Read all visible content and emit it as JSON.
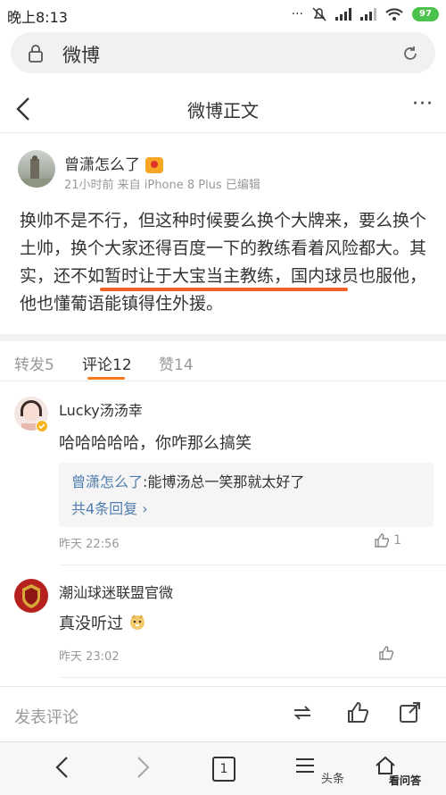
{
  "status_bar": {
    "time": "晚上8:13",
    "battery": "97"
  },
  "browser_url": {
    "text": "微博"
  },
  "nav": {
    "title": "微博正文",
    "more": "···"
  },
  "post": {
    "author": "曾潇怎么了",
    "meta": "21小时前 来自 iPhone 8 Plus 已编辑",
    "text": "换帅不是不行，但这种时候要么换个大牌来，要么换个土帅，换个大家还得百度一下的教练看着风险都大。其实，还不如暂时让于大宝当主教练，国内球员也服他，他也懂葡语能镇得住外援。"
  },
  "tabs": [
    {
      "label": "转发5"
    },
    {
      "label": "评论12"
    },
    {
      "label": "赞14"
    }
  ],
  "comments": [
    {
      "user": "Lucky汤汤幸",
      "text": "哈哈哈哈哈，你咋那么搞笑",
      "reply_user": "曾潇怎么了",
      "reply_text": ":能博汤总一笑那就太好了",
      "reply_more": "共4条回复 ›",
      "time": "昨天 22:56",
      "likes": "1"
    },
    {
      "user": "潮汕球迷联盟官微",
      "text": "真没听过",
      "time": "昨天 23:02"
    }
  ],
  "bottom_bar": {
    "placeholder": "发表评论"
  },
  "browser_bar": {
    "tab_count": "1",
    "watermark": "头条",
    "wm_site": "看问答"
  },
  "colors": {
    "accent": "#f47b20",
    "link": "#507daf",
    "underline": "#f0612a"
  }
}
